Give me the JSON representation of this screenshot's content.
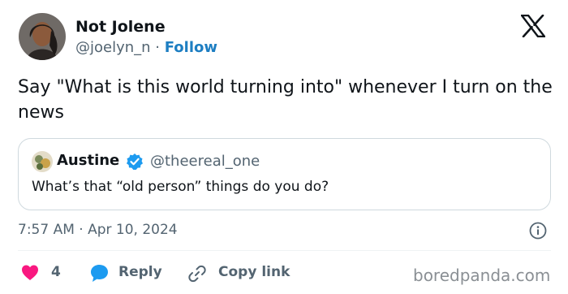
{
  "author": {
    "name": "Not Jolene",
    "handle": "@joelyn_n",
    "separator": " · ",
    "follow_label": "Follow"
  },
  "tweet": {
    "text": "Say \"What is this world turning into\" whenever I turn on the news",
    "timestamp": "7:57 AM · Apr 10, 2024"
  },
  "quoted": {
    "name": "Austine",
    "handle": "@theereal_one",
    "text": "What’s that “old person” things do you do?"
  },
  "actions": {
    "likes": "4",
    "reply_label": "Reply",
    "copy_label": "Copy link"
  },
  "watermark": "boredpanda.com",
  "colors": {
    "accent": "#1d7ec2",
    "heart": "#f91880",
    "reply_bubble": "#1d9bf0",
    "muted": "#536471",
    "verified": "#1d9bf0"
  },
  "icons": [
    "x-logo-icon",
    "verified-badge-icon",
    "info-icon",
    "heart-icon",
    "reply-icon",
    "link-icon"
  ]
}
